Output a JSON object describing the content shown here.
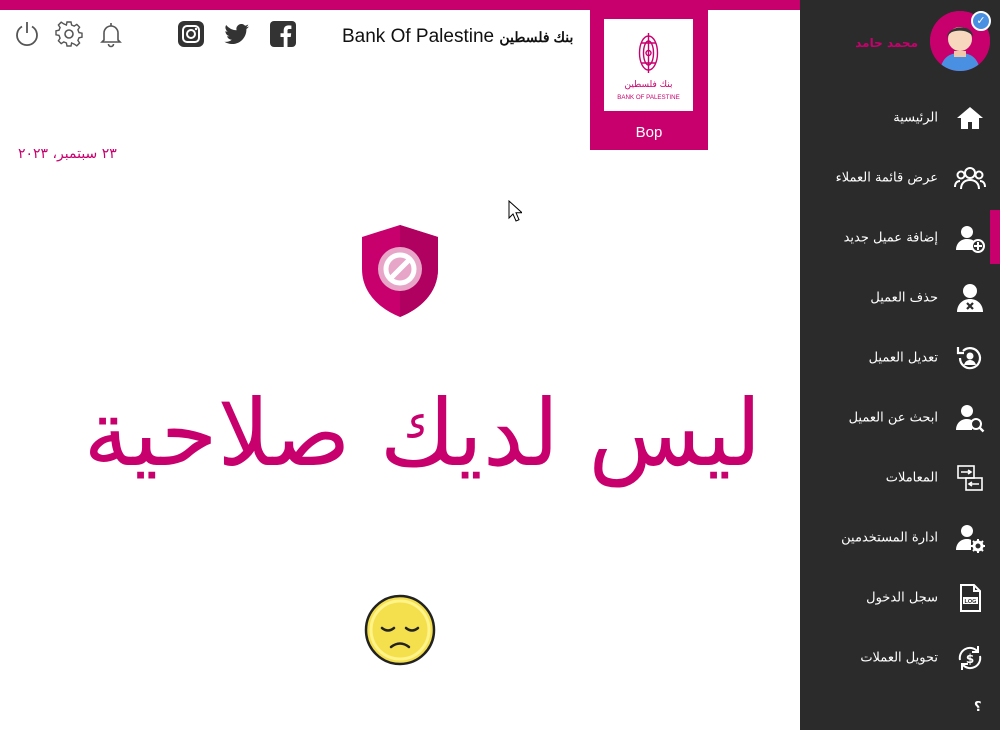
{
  "header": {
    "bank_name_en": "Bank Of Palestine",
    "bank_name_ar": "بنك فلسطين",
    "logo_caption": "Bop",
    "logo_text_ar": "بنك فلسطين",
    "logo_text_en": "BANK OF PALESTINE",
    "social_icons": [
      "instagram-icon",
      "twitter-icon",
      "facebook-icon"
    ],
    "utility_icons": [
      "power-icon",
      "gear-icon",
      "bell-icon"
    ]
  },
  "date": "٢٣ سبتمبر، ٢٠٢٣",
  "main": {
    "message": "ليس لديك صلاحية",
    "icon_top": "shield-blocked-icon",
    "icon_bottom": "sad-face-icon"
  },
  "sidebar": {
    "username": "محمد حامد",
    "active_index": 2,
    "items": [
      {
        "label": "الرئيسية",
        "icon": "home-icon"
      },
      {
        "label": "عرض قائمة العملاء",
        "icon": "users-group-icon"
      },
      {
        "label": "إضافة عميل جديد",
        "icon": "add-user-icon"
      },
      {
        "label": "حذف العميل",
        "icon": "delete-user-icon"
      },
      {
        "label": "تعديل العميل",
        "icon": "edit-user-icon"
      },
      {
        "label": "ابحث عن العميل",
        "icon": "search-user-icon"
      },
      {
        "label": "المعاملات",
        "icon": "transactions-icon"
      },
      {
        "label": "ادارة المستخدمين",
        "icon": "manage-users-icon"
      },
      {
        "label": "سجل الدخول",
        "icon": "log-file-icon"
      },
      {
        "label": "تحويل العملات",
        "icon": "currency-exchange-icon"
      }
    ],
    "help": "؟"
  },
  "colors": {
    "accent": "#c8006e",
    "sidebar_bg": "#2b2b2b",
    "text_on_dark": "#ffffff"
  }
}
